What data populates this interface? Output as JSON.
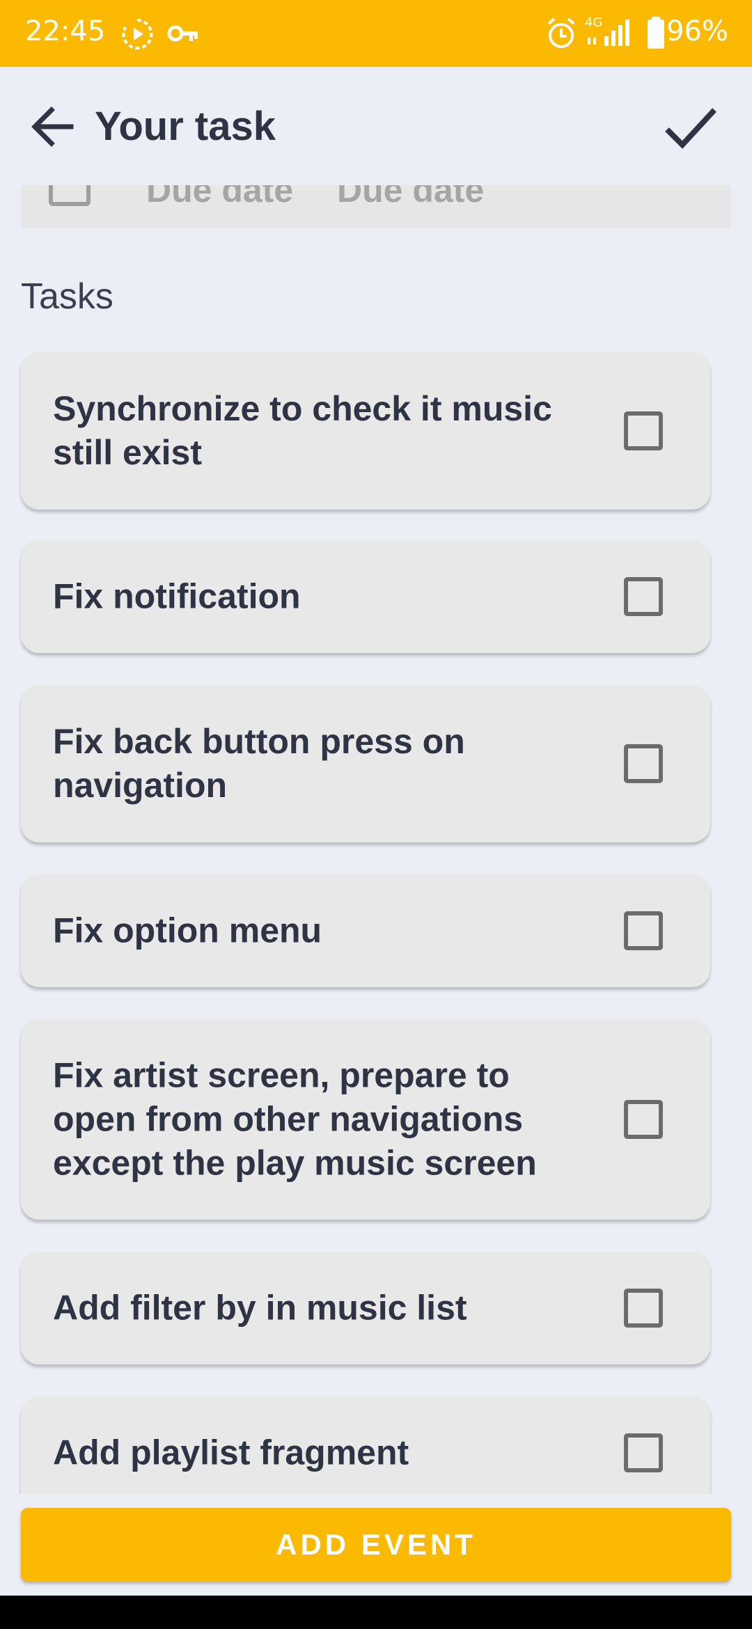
{
  "status_bar": {
    "time": "22:45",
    "network": "4G",
    "battery": "96%",
    "icons": [
      "screen-record-icon",
      "vpn-key-icon",
      "alarm-icon",
      "signal-icon",
      "battery-icon"
    ]
  },
  "toolbar": {
    "title": "Your task",
    "back_icon": "arrow-left-icon",
    "confirm_icon": "check-icon"
  },
  "due_row": {
    "labels": [
      "Due date",
      "Due date"
    ]
  },
  "tasks_section": {
    "label": "Tasks",
    "items": [
      {
        "text": "Synchronize to check it music still exist",
        "checked": false
      },
      {
        "text": "Fix notification",
        "checked": false
      },
      {
        "text": "Fix back button press on navigation",
        "checked": false
      },
      {
        "text": "Fix option menu",
        "checked": false
      },
      {
        "text": "Fix artist screen, prepare to open from other navigations except the play music screen",
        "checked": false
      },
      {
        "text": "Add filter by in music list",
        "checked": false
      },
      {
        "text": "Add playlist fragment",
        "checked": false
      }
    ]
  },
  "actions": {
    "add_event_label": "ADD EVENT"
  },
  "colors": {
    "accent": "#fbba00",
    "background": "#eceef5",
    "card": "#e8e8e8",
    "text": "#2f3344"
  }
}
